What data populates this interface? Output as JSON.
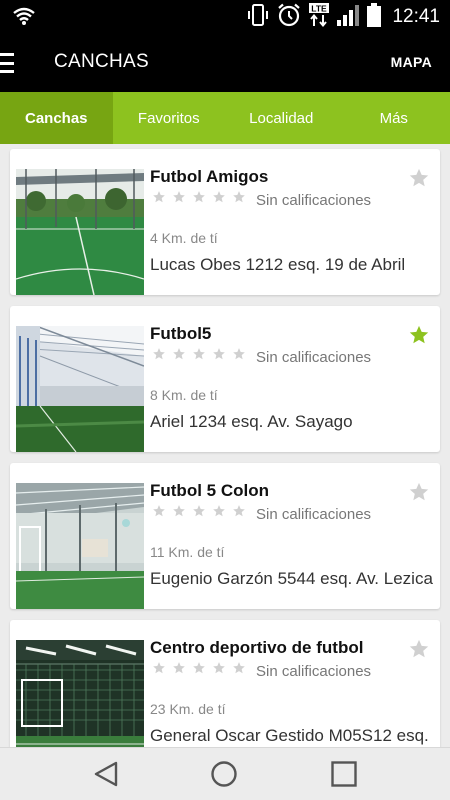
{
  "status_bar": {
    "time": "12:41",
    "network": "LTE",
    "icons": [
      "wifi-icon",
      "vibrate-icon",
      "alarm-icon",
      "lte-icon",
      "signal-icon",
      "battery-icon"
    ]
  },
  "app_bar": {
    "title": "CANCHAS",
    "map_label": "MAPA",
    "menu_icon": "hamburger-icon"
  },
  "tabs": [
    {
      "label": "Canchas",
      "active": true
    },
    {
      "label": "Favoritos",
      "active": false
    },
    {
      "label": "Localidad",
      "active": false
    },
    {
      "label": "Más",
      "active": false
    }
  ],
  "colors": {
    "accent": "#8dc21f",
    "accent_dark": "#77a512",
    "star_empty": "#d0d0d0",
    "favorite_on": "#8dc21f"
  },
  "fields": [
    {
      "name": "Futbol Amigos",
      "rating_text": "Sin calificaciones",
      "rating": 0,
      "distance": "4 Km. de tí",
      "address": "Lucas Obes 1212 esq. 19 de Abril",
      "favorite": false
    },
    {
      "name": "Futbol5",
      "rating_text": "Sin calificaciones",
      "rating": 0,
      "distance": "8 Km. de tí",
      "address": "Ariel 1234 esq. Av. Sayago",
      "favorite": true
    },
    {
      "name": "Futbol 5 Colon",
      "rating_text": "Sin calificaciones",
      "rating": 0,
      "distance": "11 Km. de tí",
      "address": "Eugenio Garzón 5544 esq. Av. Lezica",
      "favorite": false
    },
    {
      "name": "Centro deportivo de futbol",
      "rating_text": "Sin calificaciones",
      "rating": 0,
      "distance": "23 Km. de tí",
      "address": "General Oscar Gestido M05S12 esq.",
      "favorite": false
    }
  ],
  "nav": {
    "icons": [
      "back-icon",
      "home-icon",
      "recents-icon"
    ]
  }
}
